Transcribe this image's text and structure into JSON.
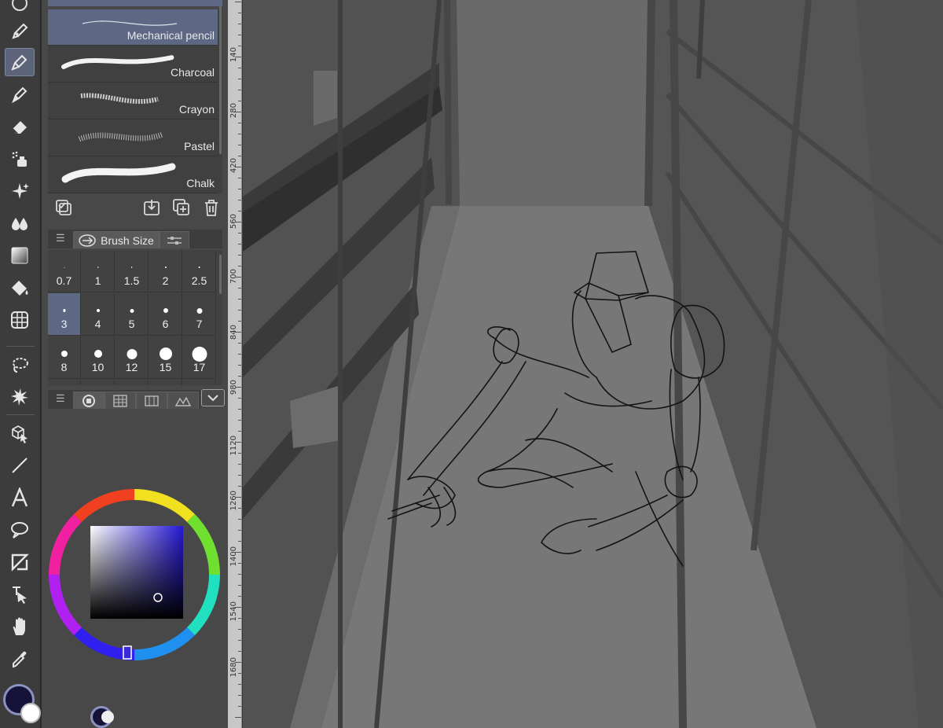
{
  "brushes": [
    {
      "name": "Mechanical pencil",
      "selected": true
    },
    {
      "name": "Charcoal",
      "selected": false
    },
    {
      "name": "Crayon",
      "selected": false
    },
    {
      "name": "Pastel",
      "selected": false
    },
    {
      "name": "Chalk",
      "selected": false
    }
  ],
  "brush_size_tab": {
    "label": "Brush Size"
  },
  "brush_sizes": [
    "0.7",
    "1",
    "1.5",
    "2",
    "2.5",
    "3",
    "4",
    "5",
    "6",
    "7",
    "8",
    "10",
    "12",
    "15",
    "17"
  ],
  "selected_brush_size": "3",
  "ruler_marks": [
    "140",
    "280",
    "420",
    "560",
    "700",
    "840",
    "980",
    "1120",
    "1260",
    "1400",
    "1540",
    "1680"
  ],
  "colors": {
    "main": "#15133a",
    "panel_selection": "#5e6884",
    "color_square_hue": "#2618d4"
  },
  "icons": {
    "toolbar": [
      "pen-icon",
      "pencil-icon",
      "brush-icon",
      "eraser-icon",
      "airbrush-icon",
      "decoration-icon",
      "blend-icon",
      "gradient-icon",
      "fill-icon",
      "figure-ruler-icon",
      "lasso-select-icon",
      "magic-wand-icon",
      "move-3d-icon",
      "line-icon",
      "text-icon",
      "balloon-icon",
      "frame-border-icon",
      "operation-icon",
      "hand-icon",
      "eyedropper-icon"
    ]
  }
}
